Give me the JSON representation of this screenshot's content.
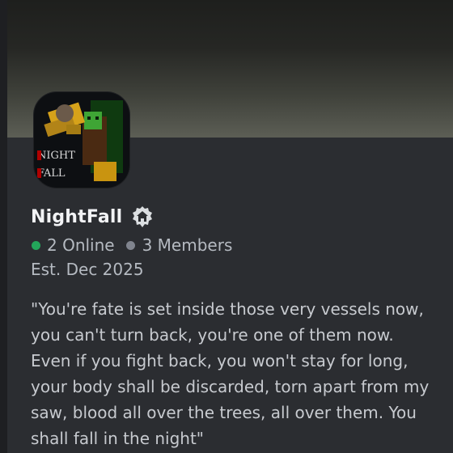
{
  "server": {
    "name": "NightFall",
    "badge_icon": "home-icon",
    "icon_text_line1": "NIGHT",
    "icon_text_line2": "FALL",
    "online_count": "2 Online",
    "member_count": "3 Members",
    "established": "Est. Dec 2025",
    "description": "\"You're fate is set inside those very vessels now, you can't turn back, you're one of them now. Even if you fight back, you won't stay for long, your body shall be discarded, torn apart from my saw, blood all over the trees, all over them. You shall fall in the night\""
  },
  "colors": {
    "online": "#23a55a",
    "offline": "#80848e",
    "background": "#2b2d31"
  }
}
